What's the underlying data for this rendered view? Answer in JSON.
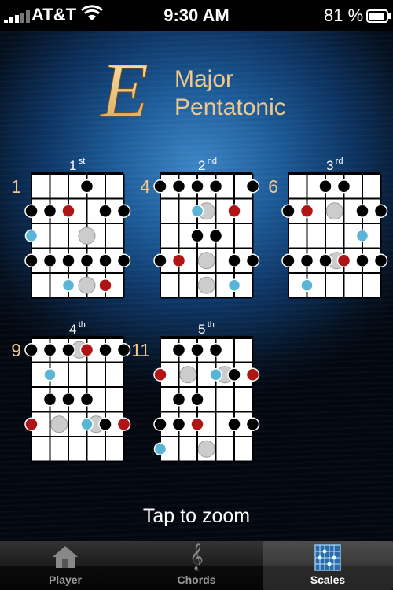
{
  "status_bar": {
    "carrier": "AT&T",
    "time": "9:30 AM",
    "battery": "81 %"
  },
  "scale": {
    "letter": "E",
    "line1": "Major",
    "line2": "Pentatonic"
  },
  "colors": {
    "root": "#b01515",
    "highlight": "#5ab4d6",
    "ghost": "#cccccc",
    "note": "#000000"
  },
  "positions": [
    {
      "ordinal": "1",
      "suffix": "st",
      "fret": "1",
      "notes": [
        [
          3,
          0,
          "n"
        ],
        [
          0,
          1,
          "n"
        ],
        [
          1,
          1,
          "n"
        ],
        [
          2,
          1,
          "r"
        ],
        [
          4,
          1,
          "n"
        ],
        [
          5,
          1,
          "n"
        ],
        [
          0,
          2,
          "h"
        ],
        [
          3,
          2,
          "g"
        ],
        [
          0,
          3,
          "n"
        ],
        [
          1,
          3,
          "n"
        ],
        [
          2,
          3,
          "n"
        ],
        [
          3,
          3,
          "n"
        ],
        [
          4,
          3,
          "n"
        ],
        [
          5,
          3,
          "n"
        ],
        [
          2,
          4,
          "h"
        ],
        [
          3,
          4,
          "g"
        ],
        [
          4,
          4,
          "r"
        ]
      ]
    },
    {
      "ordinal": "2",
      "suffix": "nd",
      "fret": "4",
      "notes": [
        [
          0,
          0,
          "n"
        ],
        [
          1,
          0,
          "n"
        ],
        [
          2,
          0,
          "n"
        ],
        [
          3,
          0,
          "n"
        ],
        [
          5,
          0,
          "n"
        ],
        [
          2,
          1,
          "h"
        ],
        [
          2.5,
          1,
          "g"
        ],
        [
          4,
          1,
          "r"
        ],
        [
          2,
          2,
          "n"
        ],
        [
          3,
          2,
          "n"
        ],
        [
          0,
          3,
          "n"
        ],
        [
          1,
          3,
          "r"
        ],
        [
          2.5,
          3,
          "g"
        ],
        [
          4,
          3,
          "n"
        ],
        [
          5,
          3,
          "n"
        ],
        [
          2.5,
          4,
          "g"
        ],
        [
          4,
          4,
          "h"
        ]
      ]
    },
    {
      "ordinal": "3",
      "suffix": "rd",
      "fret": "6",
      "notes": [
        [
          2,
          0,
          "n"
        ],
        [
          3,
          0,
          "n"
        ],
        [
          0,
          1,
          "n"
        ],
        [
          1,
          1,
          "r"
        ],
        [
          2.5,
          1,
          "g"
        ],
        [
          4,
          1,
          "n"
        ],
        [
          5,
          1,
          "n"
        ],
        [
          4,
          2,
          "h"
        ],
        [
          0,
          3,
          "n"
        ],
        [
          1,
          3,
          "n"
        ],
        [
          2,
          3,
          "n"
        ],
        [
          2.6,
          3,
          "g"
        ],
        [
          3,
          3,
          "r"
        ],
        [
          4,
          3,
          "n"
        ],
        [
          5,
          3,
          "n"
        ],
        [
          1,
          4,
          "h"
        ]
      ]
    },
    {
      "ordinal": "4",
      "suffix": "th",
      "fret": "9",
      "notes": [
        [
          0,
          0,
          "n"
        ],
        [
          1,
          0,
          "n"
        ],
        [
          2,
          0,
          "n"
        ],
        [
          2.6,
          0,
          "g"
        ],
        [
          3,
          0,
          "r"
        ],
        [
          4,
          0,
          "n"
        ],
        [
          5,
          0,
          "n"
        ],
        [
          1,
          1,
          "h"
        ],
        [
          1,
          2,
          "n"
        ],
        [
          2,
          2,
          "n"
        ],
        [
          3,
          2,
          "n"
        ],
        [
          0,
          3,
          "r"
        ],
        [
          1.5,
          3,
          "g"
        ],
        [
          3,
          3,
          "h"
        ],
        [
          3.5,
          3,
          "g"
        ],
        [
          4,
          3,
          "n"
        ],
        [
          5,
          3,
          "r"
        ]
      ]
    },
    {
      "ordinal": "5",
      "suffix": "th",
      "fret": "11",
      "notes": [
        [
          1,
          0,
          "n"
        ],
        [
          2,
          0,
          "n"
        ],
        [
          3,
          0,
          "n"
        ],
        [
          0,
          1,
          "r"
        ],
        [
          1.5,
          1,
          "g"
        ],
        [
          3,
          1,
          "h"
        ],
        [
          3.5,
          1,
          "g"
        ],
        [
          4,
          1,
          "n"
        ],
        [
          5,
          1,
          "r"
        ],
        [
          1,
          2,
          "n"
        ],
        [
          2,
          2,
          "n"
        ],
        [
          0,
          3,
          "n"
        ],
        [
          1,
          3,
          "n"
        ],
        [
          2,
          3,
          "r"
        ],
        [
          4,
          3,
          "n"
        ],
        [
          5,
          3,
          "n"
        ],
        [
          0,
          4,
          "h"
        ],
        [
          2.5,
          4,
          "g"
        ]
      ]
    }
  ],
  "hint": "Tap to zoom",
  "tabs": [
    {
      "label": "Player",
      "icon": "house-icon"
    },
    {
      "label": "Chords",
      "icon": "treble-clef-icon"
    },
    {
      "label": "Scales",
      "icon": "fretboard-icon"
    }
  ]
}
